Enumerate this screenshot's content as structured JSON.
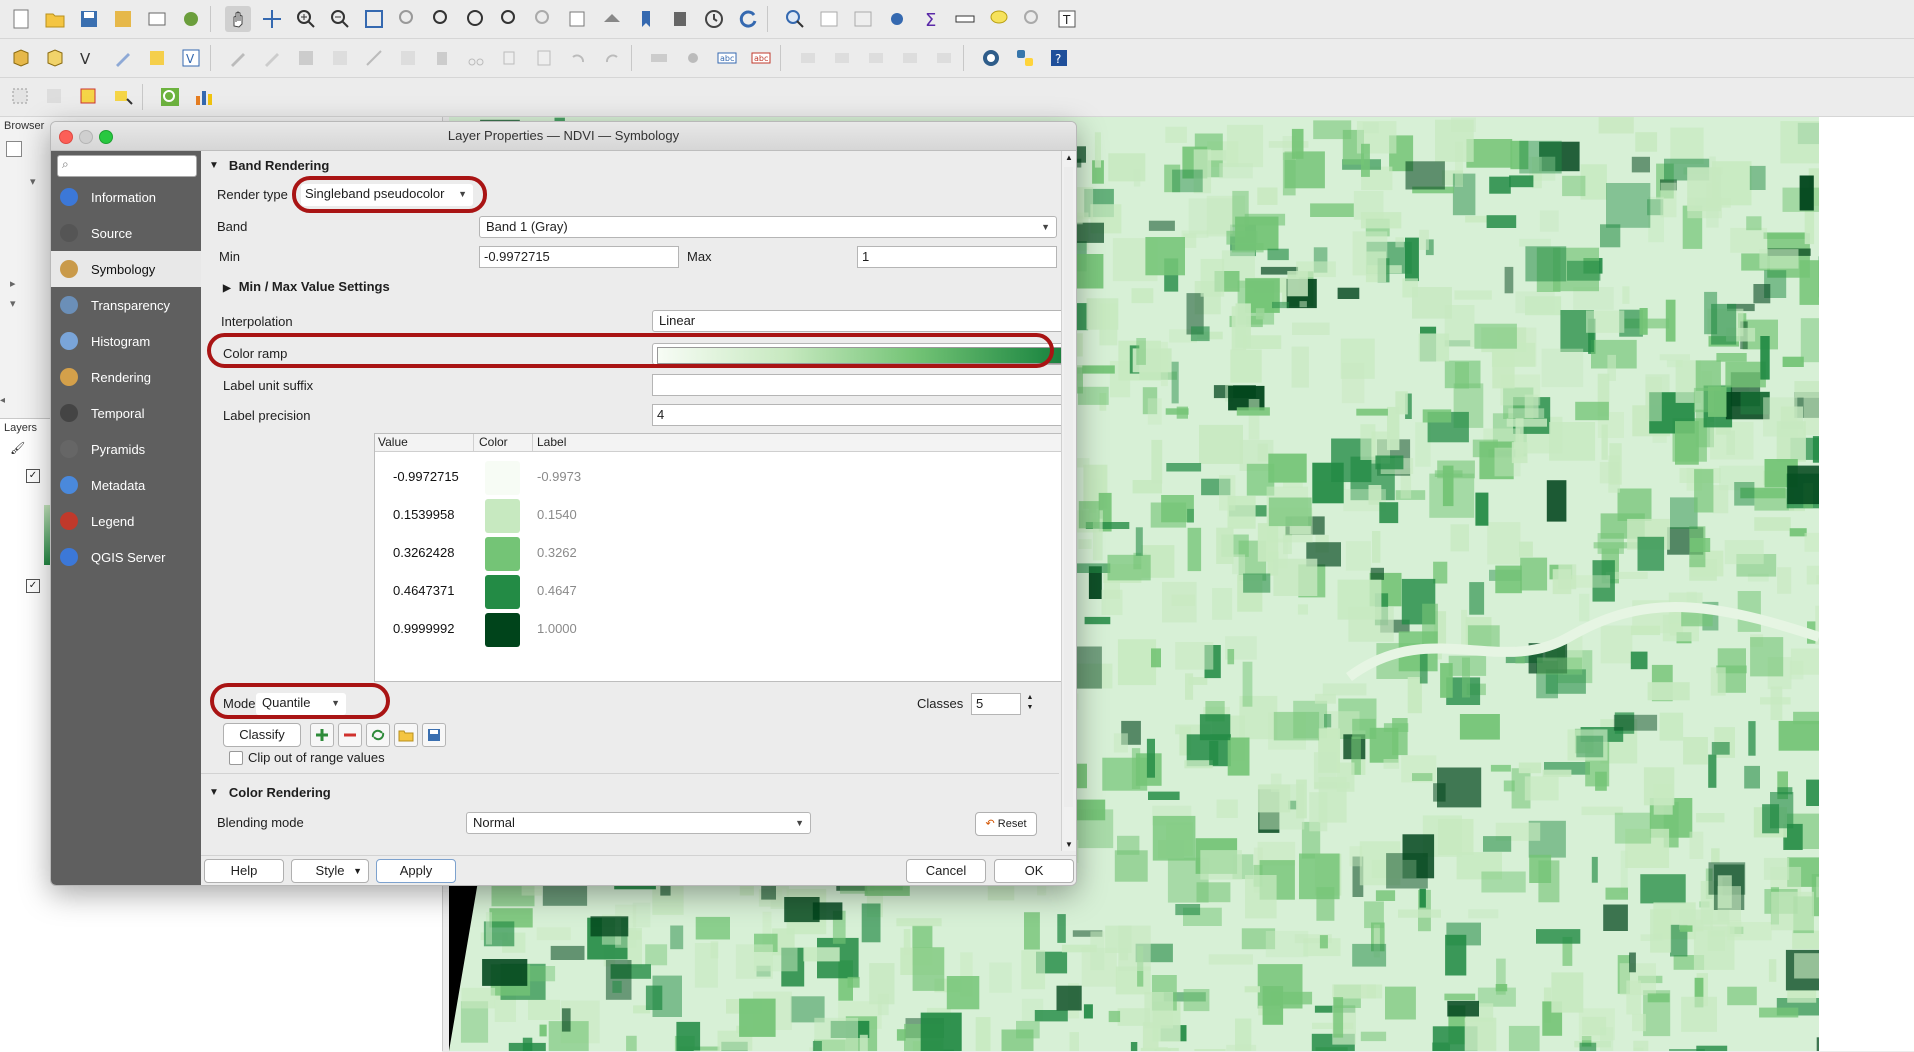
{
  "dialog": {
    "title": "Layer Properties — NDVI — Symbology"
  },
  "left_panels": {
    "browser_title": "Browser",
    "layers_title": "Layers"
  },
  "sidebar": {
    "items": [
      {
        "label": "Information",
        "icon": "info-icon"
      },
      {
        "label": "Source",
        "icon": "source-icon"
      },
      {
        "label": "Symbology",
        "icon": "symbology-icon"
      },
      {
        "label": "Transparency",
        "icon": "transparency-icon"
      },
      {
        "label": "Histogram",
        "icon": "histogram-icon"
      },
      {
        "label": "Rendering",
        "icon": "rendering-icon"
      },
      {
        "label": "Temporal",
        "icon": "clock-icon"
      },
      {
        "label": "Pyramids",
        "icon": "pyramids-icon"
      },
      {
        "label": "Metadata",
        "icon": "metadata-icon"
      },
      {
        "label": "Legend",
        "icon": "legend-icon"
      },
      {
        "label": "QGIS Server",
        "icon": "server-icon"
      }
    ],
    "active": "Symbology"
  },
  "band_rendering": {
    "header": "Band Rendering",
    "render_type_label": "Render type",
    "render_type_value": "Singleband pseudocolor",
    "band_label": "Band",
    "band_value": "Band 1 (Gray)",
    "min_label": "Min",
    "min_value": "-0.9972715",
    "max_label": "Max",
    "max_value": "1",
    "minmax_settings": "Min / Max Value Settings",
    "interpolation_label": "Interpolation",
    "interpolation_value": "Linear",
    "color_ramp_label": "Color ramp",
    "color_ramp_colors": [
      "#f7fcf5",
      "#c7e9c0",
      "#74c476",
      "#238b45",
      "#00441b"
    ],
    "label_unit_suffix_label": "Label unit suffix",
    "label_unit_suffix_value": "",
    "label_precision_label": "Label precision",
    "label_precision_value": "4"
  },
  "class_table": {
    "headers": [
      "Value",
      "Color",
      "Label"
    ],
    "rows": [
      {
        "value": "-0.9972715",
        "color": "#f7fcf5",
        "label": "-0.9973"
      },
      {
        "value": "0.1539958",
        "color": "#c7e9c0",
        "label": "0.1540"
      },
      {
        "value": "0.3262428",
        "color": "#74c476",
        "label": "0.3262"
      },
      {
        "value": "0.4647371",
        "color": "#238b45",
        "label": "0.4647"
      },
      {
        "value": "0.9999992",
        "color": "#00441b",
        "label": "1.0000"
      }
    ]
  },
  "classification": {
    "mode_label": "Mode",
    "mode_value": "Quantile",
    "classes_label": "Classes",
    "classes_value": "5",
    "classify_button": "Classify",
    "clip_label": "Clip out of range values"
  },
  "color_rendering": {
    "header": "Color Rendering",
    "blending_label": "Blending mode",
    "blending_value": "Normal",
    "reset_button": "Reset"
  },
  "footer": {
    "help": "Help",
    "style": "Style",
    "apply": "Apply",
    "cancel": "Cancel",
    "ok": "OK"
  },
  "colors": {
    "highlight_ring": "#a91414",
    "sidebar_bg": "#5f5f5f",
    "map_light_green": "#d7f0d6",
    "map_dark_green": "#238b45"
  }
}
